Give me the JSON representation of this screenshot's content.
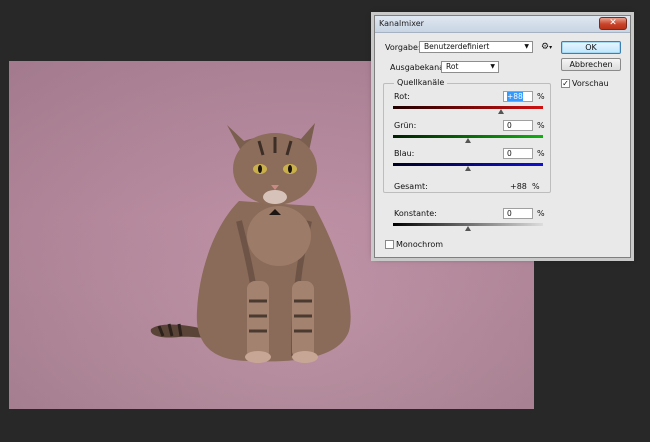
{
  "dialog": {
    "title": "Kanalmixer",
    "close_label": "✕",
    "preset_label": "Vorgabe:",
    "preset_value": "Benutzerdefiniert",
    "output_label": "Ausgabekanal:",
    "output_value": "Rot",
    "ok_label": "OK",
    "cancel_label": "Abbrechen",
    "preview_label": "Vorschau",
    "preview_checked": true,
    "source_group_label": "Quellkanäle",
    "channels": [
      {
        "label": "Rot:",
        "value": "+88",
        "unit": "%",
        "percent": 88,
        "color": "#d01010"
      },
      {
        "label": "Grün:",
        "value": "0",
        "unit": "%",
        "percent": 0,
        "color": "#10b010"
      },
      {
        "label": "Blau:",
        "value": "0",
        "unit": "%",
        "percent": 0,
        "color": "#1010d0"
      }
    ],
    "total_label": "Gesamt:",
    "total_value": "+88",
    "total_unit": "%",
    "constant_label": "Konstante:",
    "constant_value": "0",
    "constant_unit": "%",
    "constant_percent": 0,
    "monochrome_label": "Monochrom",
    "monochrome_checked": false
  },
  "colors": {
    "background": "#282828",
    "photo_tint": "#bf8ea4",
    "ok_accent": "#3c7fb1",
    "close_red": "#c8432a"
  },
  "icons": {
    "gear": "gear-icon",
    "close": "close-icon",
    "dropdown": "chevron-down-icon",
    "check": "checkmark-icon"
  }
}
